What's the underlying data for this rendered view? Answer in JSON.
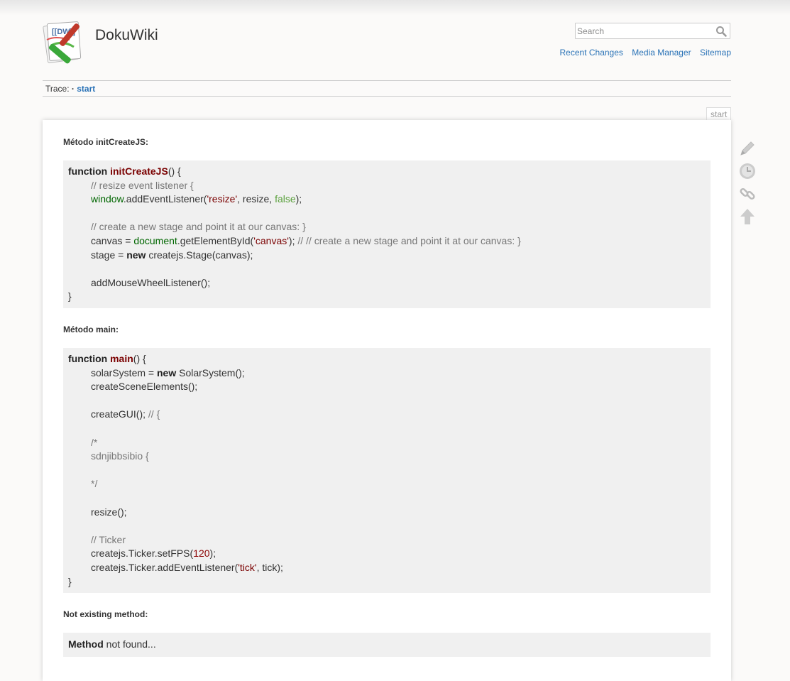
{
  "site": {
    "title": "DokuWiki"
  },
  "search": {
    "placeholder": "Search"
  },
  "usertools": [
    "Recent Changes",
    "Media Manager",
    "Sitemap"
  ],
  "breadcrumb": {
    "label": "Trace:",
    "sep": " · ",
    "item": "start"
  },
  "page": {
    "id": "start"
  },
  "sections": [
    {
      "heading": "Método initCreateJS:",
      "lines": [
        [
          {
            "t": "function ",
            "c": "kw"
          },
          {
            "t": "initCreateJS",
            "c": "fn"
          },
          {
            "t": "() {",
            "c": ""
          }
        ],
        [
          {
            "t": "INDENT",
            "c": "ind"
          },
          {
            "t": "// resize event listener {",
            "c": "cm"
          }
        ],
        [
          {
            "t": "INDENT",
            "c": "ind"
          },
          {
            "t": "window",
            "c": "gr"
          },
          {
            "t": ".addEventListener(",
            "c": ""
          },
          {
            "t": "'resize'",
            "c": "str"
          },
          {
            "t": ", resize, ",
            "c": ""
          },
          {
            "t": "false",
            "c": "bool"
          },
          {
            "t": ");",
            "c": ""
          }
        ],
        [],
        [
          {
            "t": "INDENT",
            "c": "ind"
          },
          {
            "t": "// create a new stage and point it at our canvas: }",
            "c": "cm"
          }
        ],
        [
          {
            "t": "INDENT",
            "c": "ind"
          },
          {
            "t": "canvas = ",
            "c": ""
          },
          {
            "t": "document",
            "c": "gr"
          },
          {
            "t": ".getElementById(",
            "c": ""
          },
          {
            "t": "'canvas'",
            "c": "str"
          },
          {
            "t": "); ",
            "c": ""
          },
          {
            "t": "// // create a new stage and point it at our canvas: }",
            "c": "cm"
          }
        ],
        [
          {
            "t": "INDENT",
            "c": "ind"
          },
          {
            "t": "stage = ",
            "c": ""
          },
          {
            "t": "new",
            "c": "kw"
          },
          {
            "t": " createjs.Stage(canvas);",
            "c": ""
          }
        ],
        [],
        [
          {
            "t": "INDENT",
            "c": "ind"
          },
          {
            "t": "addMouseWheelListener();",
            "c": ""
          }
        ],
        [
          {
            "t": "}",
            "c": ""
          }
        ]
      ]
    },
    {
      "heading": "Método main:",
      "lines": [
        [
          {
            "t": "function ",
            "c": "kw"
          },
          {
            "t": "main",
            "c": "fn"
          },
          {
            "t": "() {",
            "c": ""
          }
        ],
        [
          {
            "t": "INDENT",
            "c": "ind"
          },
          {
            "t": "solarSystem = ",
            "c": ""
          },
          {
            "t": "new",
            "c": "kw"
          },
          {
            "t": " SolarSystem();",
            "c": ""
          }
        ],
        [
          {
            "t": "INDENT",
            "c": "ind"
          },
          {
            "t": "createSceneElements();",
            "c": ""
          }
        ],
        [],
        [
          {
            "t": "INDENT",
            "c": "ind"
          },
          {
            "t": "createGUI(); ",
            "c": ""
          },
          {
            "t": "// {",
            "c": "cm"
          }
        ],
        [],
        [
          {
            "t": "INDENT",
            "c": "ind"
          },
          {
            "t": "/*",
            "c": "cm"
          }
        ],
        [
          {
            "t": "INDENT",
            "c": "ind"
          },
          {
            "t": "sdnjibbsibio {",
            "c": "cm"
          }
        ],
        [],
        [
          {
            "t": "INDENT",
            "c": "ind"
          },
          {
            "t": "*/",
            "c": "cm"
          }
        ],
        [],
        [
          {
            "t": "INDENT",
            "c": "ind"
          },
          {
            "t": "resize();",
            "c": ""
          }
        ],
        [],
        [
          {
            "t": "INDENT",
            "c": "ind"
          },
          {
            "t": "// Ticker",
            "c": "cm"
          }
        ],
        [
          {
            "t": "INDENT",
            "c": "ind"
          },
          {
            "t": "createjs.Ticker.setFPS(",
            "c": ""
          },
          {
            "t": "120",
            "c": "num"
          },
          {
            "t": ");",
            "c": ""
          }
        ],
        [
          {
            "t": "INDENT",
            "c": "ind"
          },
          {
            "t": "createjs.Ticker.addEventListener(",
            "c": ""
          },
          {
            "t": "'tick'",
            "c": "str"
          },
          {
            "t": ", tick);",
            "c": ""
          }
        ],
        [
          {
            "t": "}",
            "c": ""
          }
        ]
      ]
    },
    {
      "heading": "Not existing method:",
      "lines": [
        [
          {
            "t": "Method",
            "c": "kw"
          },
          {
            "t": " not found...",
            "c": ""
          }
        ]
      ]
    }
  ],
  "pagetools": [
    "edit-icon",
    "history-icon",
    "backlinks-icon",
    "back-to-top-icon"
  ]
}
